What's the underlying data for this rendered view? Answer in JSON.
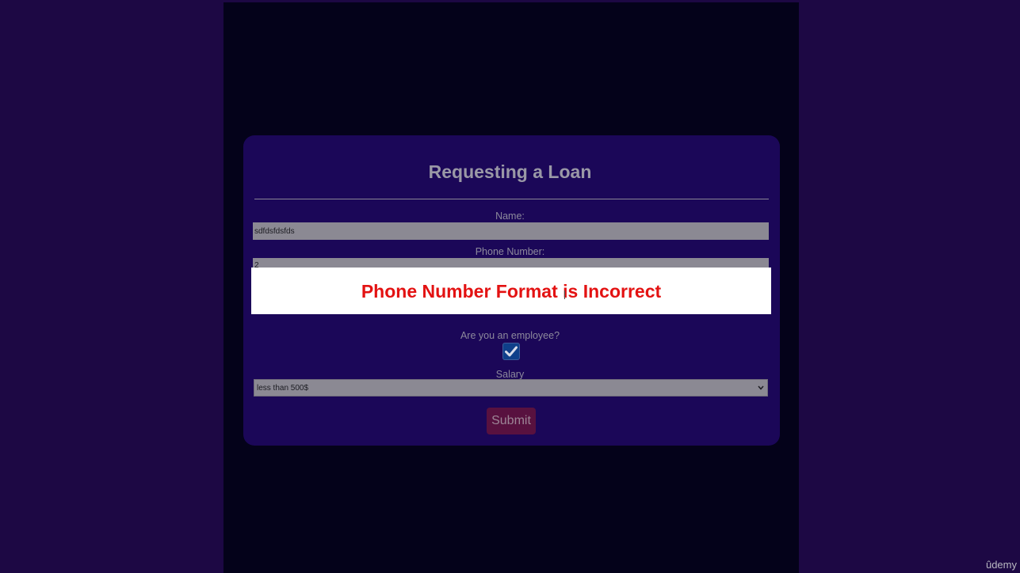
{
  "form": {
    "title": "Requesting a Loan",
    "name_label": "Name:",
    "name_value": "sdfdsfdsfds",
    "phone_label": "Phone Number:",
    "phone_value": "2",
    "employee_label": "Are you an employee?",
    "employee_checked": true,
    "salary_label": "Salary",
    "salary_selected": "less than 500$",
    "submit_label": "Submit"
  },
  "error_modal": {
    "message": "Phone Number Format is Incorrect"
  },
  "watermark": {
    "text": "ûdemy"
  },
  "colors": {
    "background": "#1d0844",
    "page": "#04021a",
    "card": "#1b0758",
    "error_text": "#e31212",
    "submit_button": "#58113f",
    "checkbox": "#0f3f8a"
  },
  "icons": {
    "checkbox_mark": "checkmark-icon",
    "select_arrow": "chevron-down-icon"
  }
}
